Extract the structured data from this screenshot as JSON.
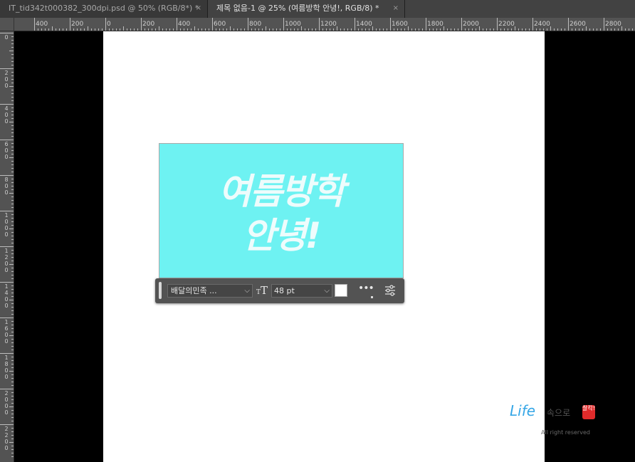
{
  "tabs": [
    {
      "title": "IT_tid342t000382_300dpi.psd @ 50% (RGB/8*) *",
      "close": "×"
    },
    {
      "title": "제목 없음-1 @ 25% (여름방학  안녕!, RGB/8) *",
      "close": "×"
    }
  ],
  "ruler": {
    "horizontal": [
      "400",
      "200",
      "0",
      "200",
      "400",
      "600",
      "800",
      "1000",
      "1200",
      "1400",
      "1600",
      "1800",
      "2000",
      "2200",
      "2400",
      "2600",
      "2800"
    ],
    "vertical": [
      "0",
      "200",
      "400",
      "600",
      "800",
      "1000",
      "1200",
      "1400",
      "1600",
      "1800",
      "2000",
      "2200"
    ]
  },
  "canvas": {
    "headline_line1": "여름방학",
    "headline_line2": "안녕!",
    "cyan": "#6ef2f2"
  },
  "taskbar": {
    "font_family": "배달의민족 ...",
    "font_size": "48 pt",
    "text_color": "#ffffff",
    "more": "•••"
  },
  "watermark": {
    "life": "Life",
    "korean": "속으로",
    "stamp": "찰칵!",
    "reserved": "All right reserved"
  }
}
